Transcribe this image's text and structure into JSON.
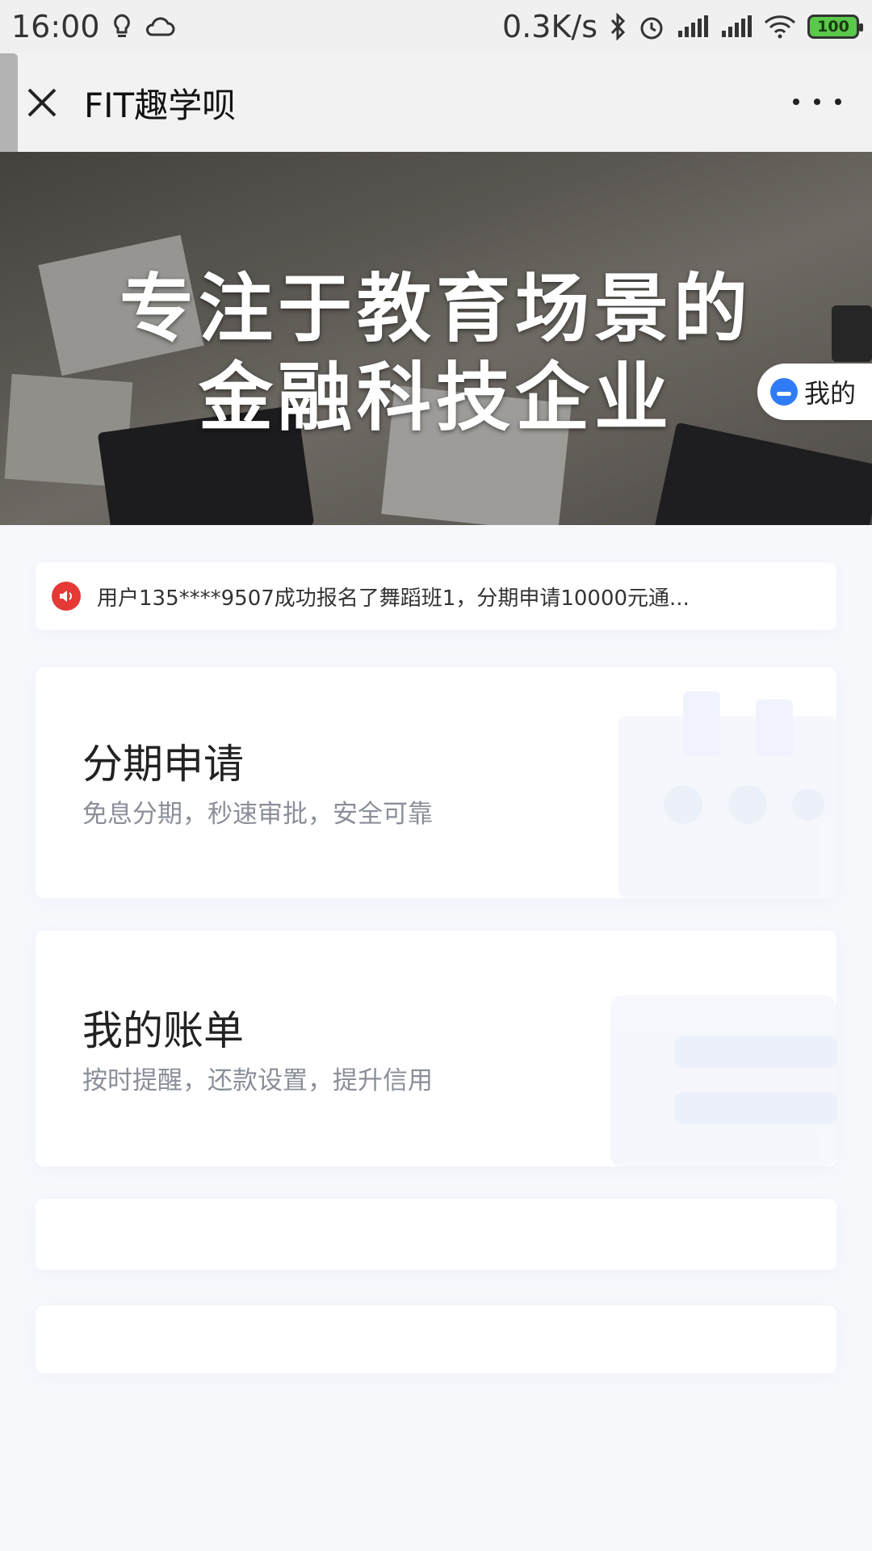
{
  "status_bar": {
    "time": "16:00",
    "network_speed": "0.3K/s",
    "battery": "100"
  },
  "nav": {
    "title": "FIT趣学呗"
  },
  "banner": {
    "line1": "专注于教育场景的",
    "line2": "金融科技企业",
    "mine_label": "我的"
  },
  "notice": {
    "text": "用户135****9507成功报名了舞蹈班1，分期申请10000元通..."
  },
  "cards": [
    {
      "title": "分期申请",
      "subtitle": "免息分期，秒速审批，安全可靠"
    },
    {
      "title": "我的账单",
      "subtitle": "按时提醒，还款设置，提升信用"
    }
  ],
  "colors": {
    "accent": "#2f7cf6",
    "notice_icon": "#e53935",
    "background": "#f6f8fc"
  },
  "icons": [
    "bulb-icon",
    "cloud-icon",
    "bluetooth-icon",
    "alarm-icon",
    "signal-icon",
    "wifi-icon",
    "battery-icon",
    "close-icon",
    "more-icon",
    "speaker-icon"
  ]
}
